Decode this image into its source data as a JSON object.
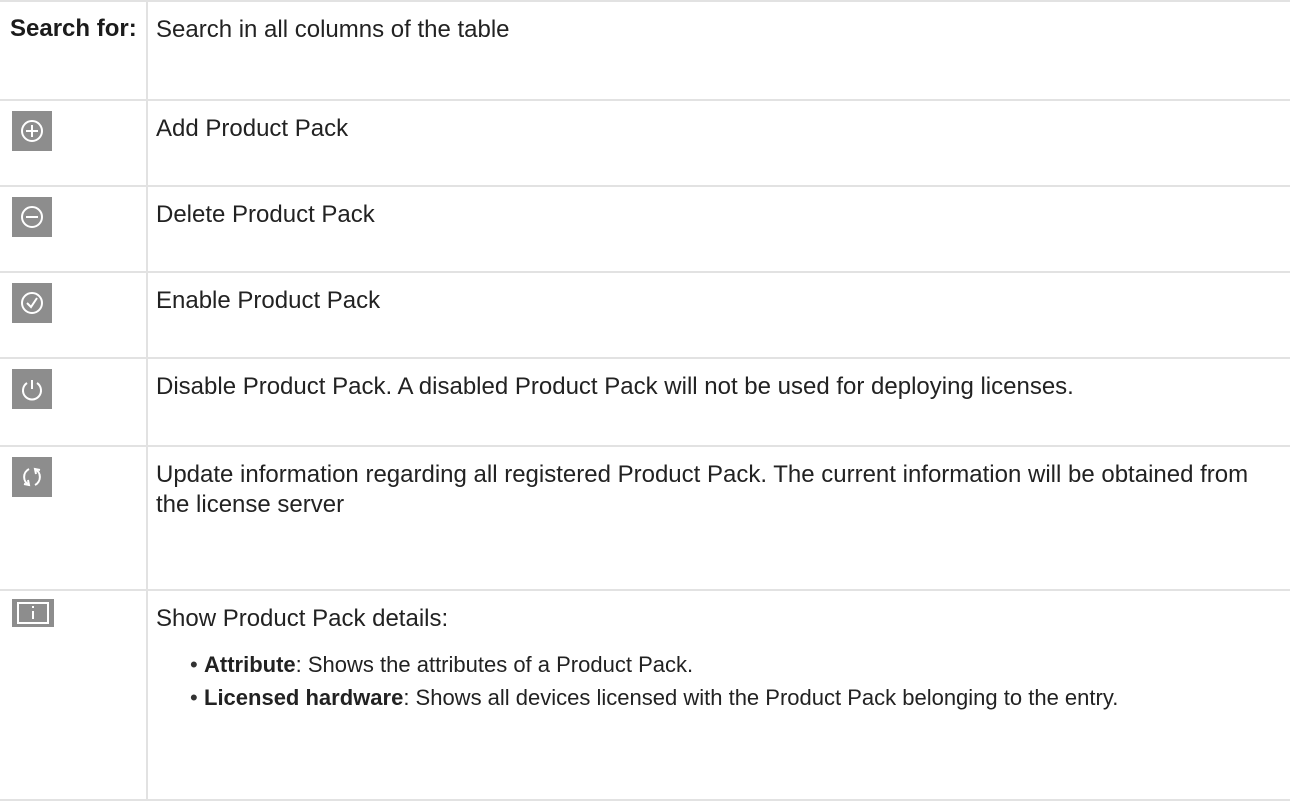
{
  "search": {
    "label": "Search for:",
    "description": "Search in all columns of the table"
  },
  "rows": [
    {
      "icon": "add-circle-icon",
      "description": "Add Product Pack"
    },
    {
      "icon": "remove-circle-icon",
      "description": "Delete Product Pack"
    },
    {
      "icon": "check-circle-icon",
      "description": "Enable Product Pack"
    },
    {
      "icon": "power-icon",
      "description": "Disable Product Pack. A disabled Product Pack will not be used for deploying licenses."
    },
    {
      "icon": "refresh-icon",
      "description": "Update information regarding all registered Product Pack. The current information will be obtained from the license server"
    }
  ],
  "details": {
    "icon": "info-icon",
    "description": "Show Product Pack details:",
    "items": [
      {
        "term": "Attribute",
        "text": ": Shows the attributes of a Product Pack."
      },
      {
        "term": "Licensed hardware",
        "text": ": Shows all devices licensed with the Product Pack belonging to the entry."
      }
    ]
  },
  "colors": {
    "icon_background": "#8d8d8d",
    "border": "#e2e2e2"
  }
}
